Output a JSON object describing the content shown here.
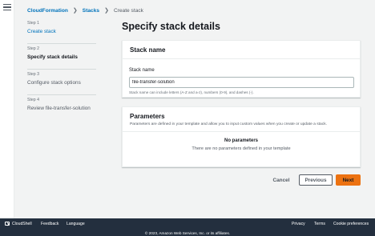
{
  "breadcrumb": {
    "home": "CloudFormation",
    "stacks": "Stacks",
    "current": "Create stack"
  },
  "steps": [
    {
      "num": "Step 1",
      "label": "Create stack"
    },
    {
      "num": "Step 2",
      "label": "Specify stack details"
    },
    {
      "num": "Step 3",
      "label": "Configure stack options"
    },
    {
      "num": "Step 4",
      "label": "Review file-transfer-solution"
    }
  ],
  "page": {
    "title": "Specify stack details"
  },
  "stack_name_panel": {
    "title": "Stack name",
    "field_label": "Stack name",
    "value": "file-transfer-solution",
    "hint": "Stack name can include letters (A-Z and a-z), numbers (0-9), and dashes (-)."
  },
  "parameters_panel": {
    "title": "Parameters",
    "description": "Parameters are defined in your template and allow you to input custom values when you create or update a stack.",
    "empty_title": "No parameters",
    "empty_text": "There are no parameters defined in your template"
  },
  "actions": {
    "cancel": "Cancel",
    "previous": "Previous",
    "next": "Next"
  },
  "footer": {
    "cloudshell": "CloudShell",
    "feedback": "Feedback",
    "language": "Language",
    "privacy": "Privacy",
    "terms": "Terms",
    "cookies": "Cookie preferences",
    "copyright": "© 2023, Amazon Web Services, Inc. or its affiliates."
  },
  "colors": {
    "link": "#0073bb",
    "primary_button": "#ec7211",
    "footer_bg": "#232f3e",
    "page_bg": "#f2f3f3"
  }
}
